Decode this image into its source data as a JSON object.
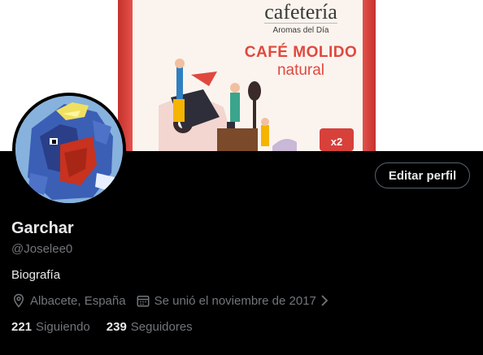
{
  "banner": {
    "brand": "cafetería",
    "tagline": "Aromas del Día",
    "product_line1": "CAFÉ MOLIDO",
    "product_line2": "natural",
    "pack_count": "x2"
  },
  "profile": {
    "name": "Garchar",
    "handle": "@Joselee0",
    "bio": "Biografía",
    "location": "Albacete, España",
    "joined": "Se unió el noviembre de 2017",
    "edit_label": "Editar perfil"
  },
  "stats": {
    "following_count": "221",
    "following_label": "Siguiendo",
    "followers_count": "239",
    "followers_label": "Seguidores"
  },
  "icons": {
    "location": "location-pin-icon",
    "calendar": "calendar-icon",
    "chevron": "chevron-right-icon"
  },
  "colors": {
    "background": "#000000",
    "text": "#e7e9ea",
    "secondary": "#71767b",
    "banner_red": "#d8403a"
  }
}
